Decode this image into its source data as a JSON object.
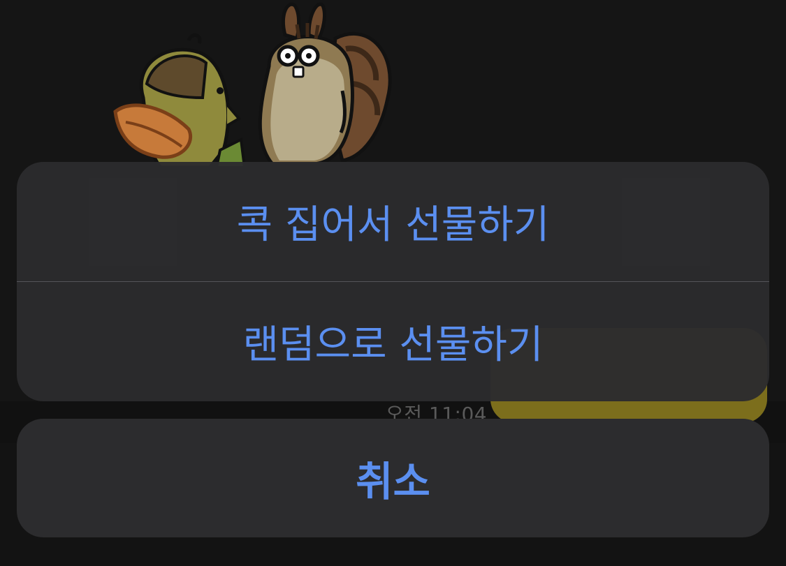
{
  "background": {
    "message_time": "오전 11:04",
    "sticker_icon": "squirrel-and-bird-sticker-icon"
  },
  "action_sheet": {
    "options": [
      {
        "label": "콕 집어서 선물하기"
      },
      {
        "label": "랜덤으로 선물하기"
      }
    ],
    "cancel_label": "취소"
  },
  "colors": {
    "accent": "#5b8ff0",
    "sheet_bg": "#2c2c2e",
    "bubble": "#7c6e1c"
  }
}
